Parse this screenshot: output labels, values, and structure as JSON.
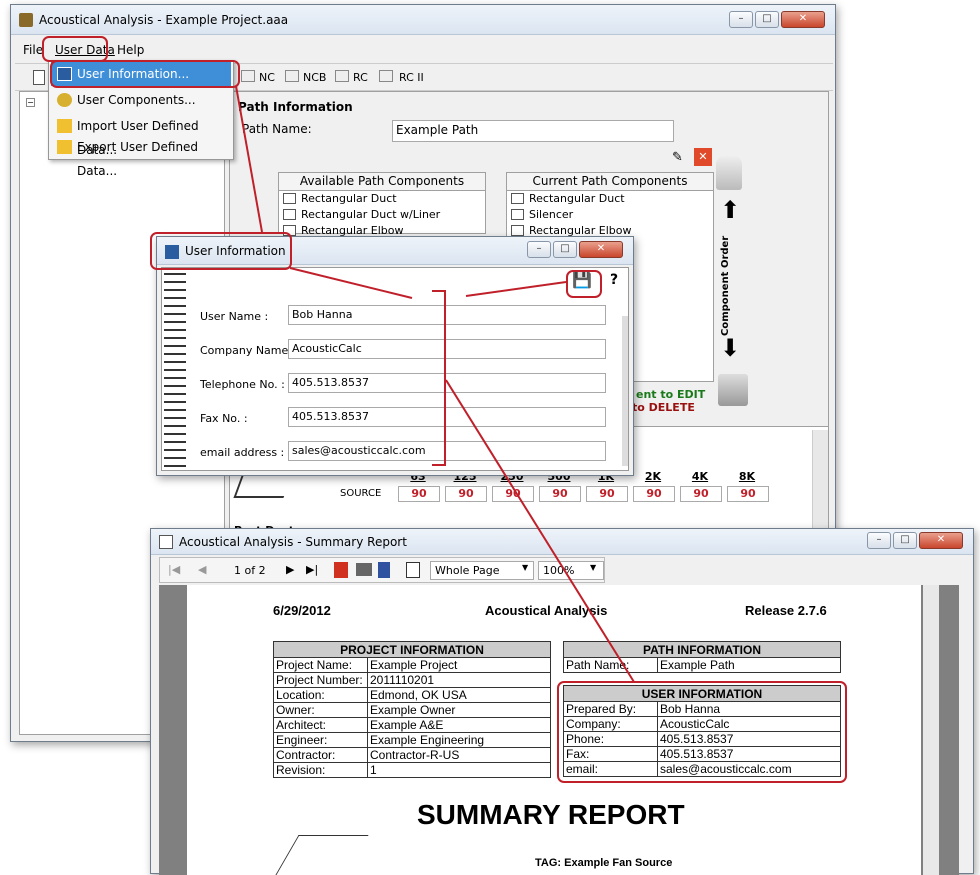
{
  "main_window": {
    "title": "Acoustical Analysis - Example Project.aaa",
    "min": "–",
    "max": "□",
    "close": "✕"
  },
  "menu": {
    "file": "File",
    "user_data": "User Data",
    "help": "Help"
  },
  "dropdown": {
    "items": [
      "User Information...",
      "User Components...",
      "Import User Defined Data...",
      "Export User Defined Data..."
    ]
  },
  "toolbar": {
    "nc": "NC",
    "ncb": "NCB",
    "rc": "RC",
    "rc2": "RC II"
  },
  "path": {
    "section_title": "Path Information",
    "name_label": "Path Name:",
    "name_value": "Example Path",
    "available_header": "Available Path Components",
    "available": [
      "Rectangular Duct",
      "Rectangular Duct w/Liner",
      "Rectangular Elbow"
    ],
    "current_header": "Current Path Components",
    "current": [
      "Rectangular Duct",
      "Silencer",
      "Rectangular Elbow"
    ],
    "order_label": "Component Order",
    "hint_edit": "ent to EDIT",
    "hint_delete": "to DELETE"
  },
  "octave": {
    "source_label": "SOURCE",
    "bands": [
      "63",
      "125",
      "250",
      "500",
      "1K",
      "2K",
      "4K",
      "8K"
    ],
    "values": [
      "90",
      "90",
      "90",
      "90",
      "90",
      "90",
      "90",
      "90"
    ]
  },
  "partial_label": "Post Dust",
  "user_info_dialog": {
    "title": "User Information",
    "save_icon": "💾",
    "help_icon": "?",
    "fields": [
      {
        "label": "User Name :",
        "value": "Bob Hanna"
      },
      {
        "label": "Company Name :",
        "value": "AcousticCalc"
      },
      {
        "label": "Telephone No. :",
        "value": "405.513.8537"
      },
      {
        "label": "Fax No. :",
        "value": "405.513.8537"
      },
      {
        "label": "email address :",
        "value": "sales@acousticcalc.com"
      }
    ]
  },
  "report_window": {
    "title": "Acoustical Analysis - Summary Report",
    "page": "1 of 2",
    "view": "Whole Page",
    "zoom": "100%"
  },
  "report": {
    "date": "6/29/2012",
    "heading": "Acoustical Analysis",
    "release": "Release 2.7.6",
    "project_header": "PROJECT INFORMATION",
    "project": [
      [
        "Project Name:",
        "Example Project"
      ],
      [
        "Project Number:",
        "2011110201"
      ],
      [
        "Location:",
        "Edmond, OK USA"
      ],
      [
        "Owner:",
        "Example Owner"
      ],
      [
        "Architect:",
        "Example A&E"
      ],
      [
        "Engineer:",
        "Example Engineering"
      ],
      [
        "Contractor:",
        "Contractor-R-US"
      ],
      [
        "Revision:",
        "1"
      ]
    ],
    "path_header": "PATH INFORMATION",
    "path": [
      [
        "Path Name:",
        "Example Path"
      ]
    ],
    "user_header": "USER INFORMATION",
    "user": [
      [
        "Prepared By:",
        "Bob Hanna"
      ],
      [
        "Company:",
        "AcousticCalc"
      ],
      [
        "Phone:",
        "405.513.8537"
      ],
      [
        "Fax:",
        "405.513.8537"
      ],
      [
        "email:",
        "sales@acousticcalc.com"
      ]
    ],
    "summary_title": "SUMMARY REPORT",
    "tag": "TAG: Example Fan Source"
  },
  "colors": {
    "highlight": "#c0202a",
    "menu_select": "#3f8fd8",
    "title_bar": "#dbe5f1"
  }
}
